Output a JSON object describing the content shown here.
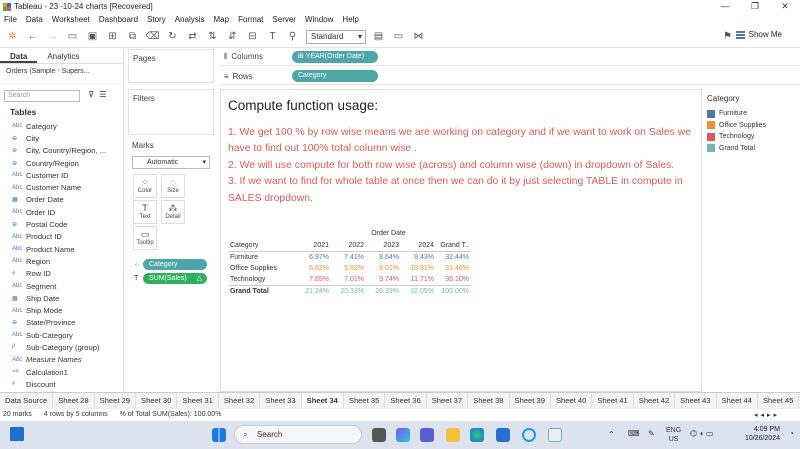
{
  "window": {
    "title": "Tableau - 23 -10-24 charts [Recovered]"
  },
  "menu": [
    "File",
    "Data",
    "Worksheet",
    "Dashboard",
    "Story",
    "Analysis",
    "Map",
    "Format",
    "Server",
    "Window",
    "Help"
  ],
  "toolbar": {
    "fit_select": "Standard",
    "show_me": "Show Me"
  },
  "datapane": {
    "tab_data": "Data",
    "tab_analytics": "Analytics",
    "source": "Orders (Sample - Supers...",
    "search_placeholder": "Search",
    "tables_heading": "Tables",
    "fields": [
      {
        "type": "Abc",
        "name": "Category"
      },
      {
        "type": "⊕",
        "name": "City"
      },
      {
        "type": "⊕",
        "name": "City, Country/Region, ..."
      },
      {
        "type": "⊕",
        "name": "Country/Region"
      },
      {
        "type": "Abc",
        "name": "Customer ID"
      },
      {
        "type": "Abc",
        "name": "Customer Name"
      },
      {
        "type": "▦",
        "name": "Order Date"
      },
      {
        "type": "Abc",
        "name": "Order ID"
      },
      {
        "type": "⊕",
        "name": "Postal Code"
      },
      {
        "type": "Abc",
        "name": "Product ID"
      },
      {
        "type": "Abc",
        "name": "Product Name"
      },
      {
        "type": "Abc",
        "name": "Region"
      },
      {
        "type": "#",
        "name": "Row ID"
      },
      {
        "type": "Abc",
        "name": "Segment"
      },
      {
        "type": "▦",
        "name": "Ship Date"
      },
      {
        "type": "Abc",
        "name": "Ship Mode"
      },
      {
        "type": "⊕",
        "name": "State/Province"
      },
      {
        "type": "Abc",
        "name": "Sub-Category"
      },
      {
        "type": "∂",
        "name": "Sub-Category (group)"
      },
      {
        "type": "Abc",
        "name": "Measure Names",
        "italic": true
      },
      {
        "type": "=#",
        "name": "Calculation1",
        "measure": true
      },
      {
        "type": "#",
        "name": "Discount",
        "measure": true
      }
    ]
  },
  "cards": {
    "pages": "Pages",
    "filters": "Filters",
    "marks": "Marks",
    "mark_type": "Automatic",
    "buttons": [
      {
        "icon": "⁘",
        "label": "Color"
      },
      {
        "icon": "◌",
        "label": "Size"
      },
      {
        "icon": "T",
        "label": "Text"
      },
      {
        "icon": "⁂",
        "label": "Detail"
      },
      {
        "icon": "▭",
        "label": "Tooltip"
      }
    ],
    "pill_category": "Category",
    "pill_sales": "SUM(Sales)"
  },
  "shelves": {
    "columns_label": "Columns",
    "columns_pill": "⊞ YEAR(Order Date)",
    "rows_label": "Rows",
    "rows_pill": "Category"
  },
  "sheet": {
    "heading": "Compute function usage:",
    "notes": [
      "1. We get 100 % by row wise means we are working on category  and if we want to work on Sales we have to find out 100% total column wise .",
      "2. We will use compute for both row wise (across) and column wise (down)  in dropdown of Sales.",
      "3. If we want to find for whole table at once then we can do it by just selecting TABLE in compute in SALES dropdown."
    ],
    "table": {
      "super_header": "Order Date",
      "row_header": "Category",
      "columns": [
        "2021",
        "2022",
        "2023",
        "2024",
        "Grand T.."
      ],
      "rows": [
        {
          "label": "Furniture",
          "color": "#4e79a7",
          "values": [
            "6.97%",
            "7.41%",
            "8.64%",
            "9.43%",
            "32.44%"
          ]
        },
        {
          "label": "Office Supplies",
          "color": "#f28e2b",
          "values": [
            "6.62%",
            "5.92%",
            "8.01%",
            "10.91%",
            "31.46%"
          ]
        },
        {
          "label": "Technology",
          "color": "#e15759",
          "values": [
            "7.65%",
            "7.01%",
            "9.74%",
            "11.71%",
            "36.10%"
          ]
        },
        {
          "label": "Grand Total",
          "color": "#76b7b2",
          "values": [
            "21.24%",
            "20.33%",
            "26.39%",
            "32.05%",
            "100.00%"
          ]
        }
      ]
    }
  },
  "legend": {
    "title": "Category",
    "items": [
      {
        "label": "Furniture",
        "color": "#4e79a7"
      },
      {
        "label": "Office Supplies",
        "color": "#f28e2b"
      },
      {
        "label": "Technology",
        "color": "#e15759"
      },
      {
        "label": "Grand Total",
        "color": "#76b7b2"
      }
    ]
  },
  "tabs": {
    "data_source": "Data Source",
    "sheets": [
      "Sheet 28",
      "Sheet 29",
      "Sheet 30",
      "Sheet 31",
      "Sheet 32",
      "Sheet 33",
      "Sheet 34",
      "Sheet 35",
      "Sheet 36",
      "Sheet 37",
      "Sheet 38",
      "Sheet 39",
      "Sheet 40",
      "Sheet 41",
      "Sheet 42",
      "Sheet 43",
      "Sheet 44",
      "Sheet 45"
    ],
    "active": "Sheet 34"
  },
  "status": {
    "marks": "20 marks",
    "rows": "4 rows by 5 columns",
    "total": "% of Total SUM(Sales): 100.00%"
  },
  "taskbar": {
    "search": "Search",
    "lang1": "ENG",
    "lang2": "US",
    "time": "4:09 PM",
    "date": "10/26/2024"
  }
}
